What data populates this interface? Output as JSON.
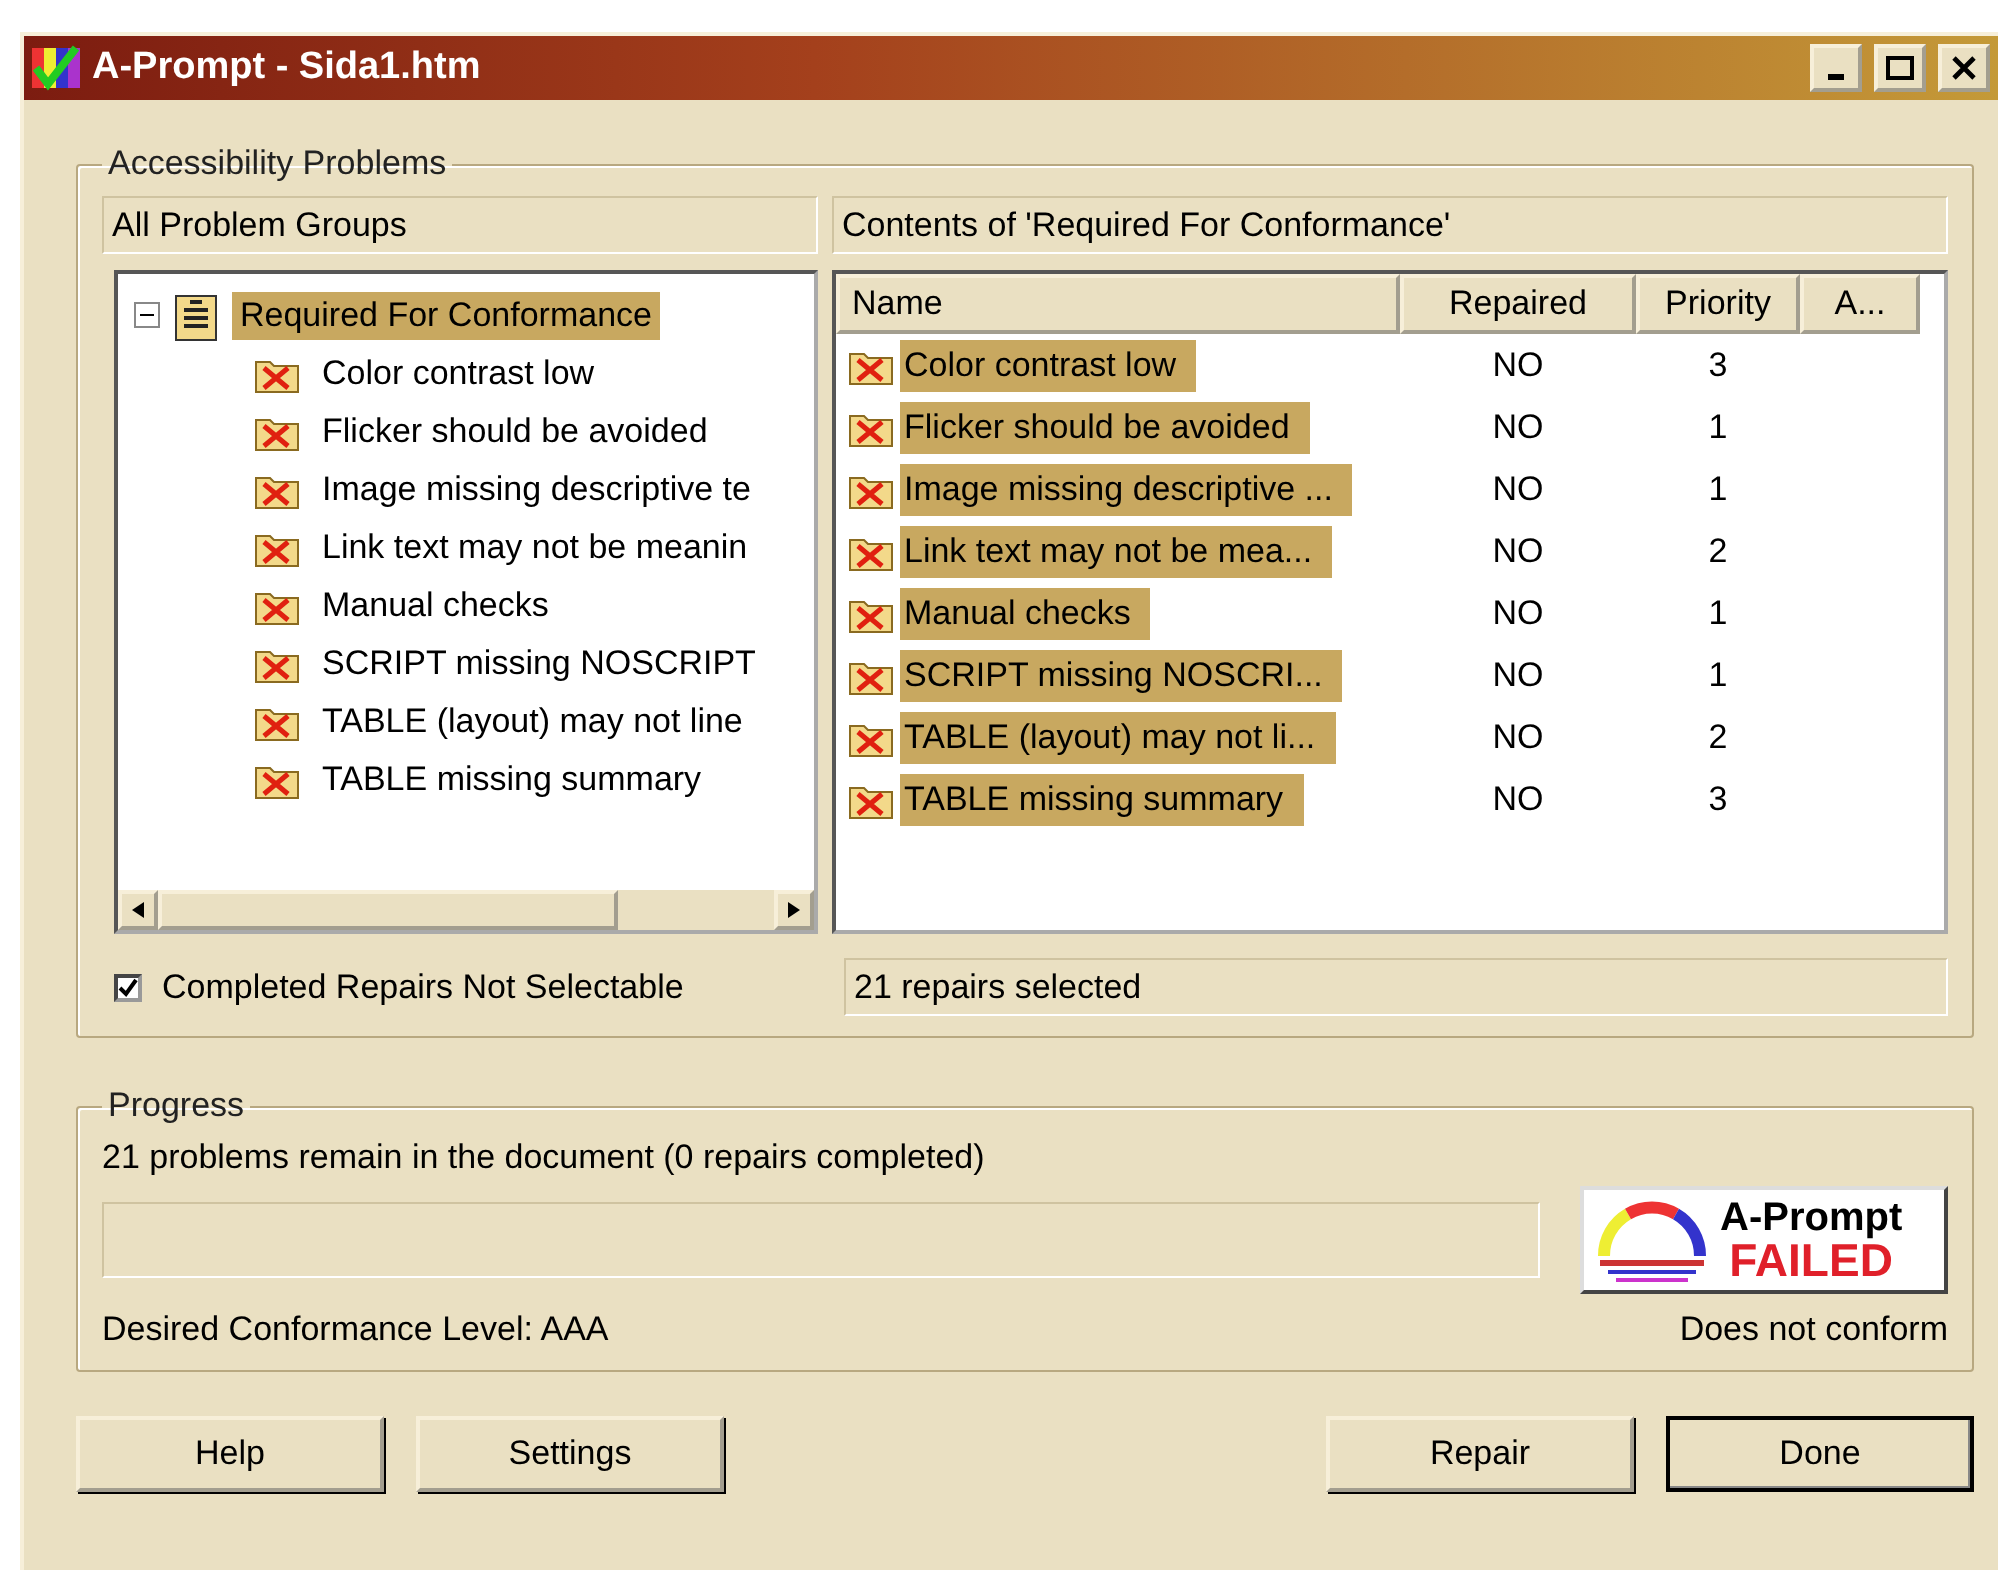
{
  "window": {
    "title": "A-Prompt - Sida1.htm"
  },
  "problems": {
    "title": "Accessibility Problems",
    "groups_header": "All Problem Groups",
    "tree": [
      {
        "label": "Required For Conformance",
        "expanded": true,
        "selected": true,
        "children": [
          {
            "label": "Color contrast low",
            "selected": false
          },
          {
            "label": "Flicker should be avoided",
            "selected": false
          },
          {
            "label": "Image missing descriptive te",
            "selected": false
          },
          {
            "label": "Link text may not be meanin",
            "selected": false
          },
          {
            "label": "Manual checks",
            "selected": false
          },
          {
            "label": "SCRIPT missing NOSCRIPT",
            "selected": false
          },
          {
            "label": "TABLE (layout) may not line",
            "selected": false
          },
          {
            "label": "TABLE missing summary",
            "selected": false
          }
        ]
      }
    ],
    "contents_header": "Contents of 'Required For Conformance'",
    "table": {
      "columns": [
        "Name",
        "Repaired",
        "Priority",
        "A..."
      ],
      "rows": [
        {
          "name": "Color contrast low",
          "repaired": "NO",
          "priority": "3",
          "selected": true
        },
        {
          "name": "Flicker should be avoided",
          "repaired": "NO",
          "priority": "1",
          "selected": true
        },
        {
          "name": "Image missing descriptive ...",
          "repaired": "NO",
          "priority": "1",
          "selected": true
        },
        {
          "name": "Link text may not be mea...",
          "repaired": "NO",
          "priority": "2",
          "selected": true
        },
        {
          "name": "Manual checks",
          "repaired": "NO",
          "priority": "1",
          "selected": true
        },
        {
          "name": "SCRIPT missing NOSCRI...",
          "repaired": "NO",
          "priority": "1",
          "selected": true
        },
        {
          "name": "TABLE (layout) may not li...",
          "repaired": "NO",
          "priority": "2",
          "selected": true
        },
        {
          "name": "TABLE missing summary",
          "repaired": "NO",
          "priority": "3",
          "selected": true
        }
      ]
    },
    "completed_checkbox": {
      "label": "Completed Repairs Not Selectable",
      "checked": true
    },
    "selection_status": "21 repairs selected"
  },
  "progress": {
    "title": "Progress",
    "message": "21 problems remain in the document (0 repairs completed)",
    "level": 0,
    "badge": {
      "line1": "A-Prompt",
      "line2": "FAILED"
    },
    "conformance_level": "Desired Conformance Level: AAA",
    "conformance_status": "Does not conform"
  },
  "buttons": [
    "Help",
    "Settings",
    "Repair",
    "Done"
  ]
}
